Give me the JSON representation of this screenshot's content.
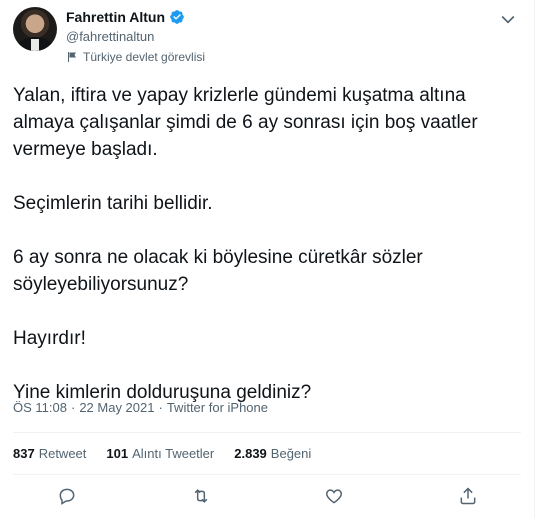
{
  "author": {
    "name": "Fahrettin Altun",
    "handle": "@fahrettinaltun",
    "label": "Türkiye devlet görevlisi"
  },
  "tweet": {
    "paragraphs": [
      [
        "Yalan, iftira ve yapay krizlerle gündemi kuşatma altına",
        "almaya çalışanlar şimdi de 6 ay sonrası için boş vaatler",
        "vermeye başladı."
      ],
      [
        "Seçimlerin tarihi bellidir."
      ],
      [
        "6 ay sonra ne olacak ki böylesine cüretkâr sözler",
        "söyleyebiliyorsunuz?"
      ],
      [
        "Hayırdır!"
      ],
      [
        "Yine kimlerin dolduruşuna geldiniz?"
      ]
    ],
    "time": "ÖS 11:08",
    "date": "22 May 2021",
    "source": "Twitter for iPhone",
    "separator": "·"
  },
  "stats": {
    "retweets": {
      "count": "837",
      "label": "Retweet"
    },
    "quotes": {
      "count": "101",
      "label": "Alıntı Tweetler"
    },
    "likes": {
      "count": "2.839",
      "label": "Beğeni"
    }
  },
  "colors": {
    "verified": "#1d9bf0",
    "secondary_text": "#536471"
  },
  "icons": [
    "verified-badge-icon",
    "flag-icon",
    "more-caret-icon",
    "reply-icon",
    "retweet-icon",
    "like-icon",
    "share-icon"
  ]
}
